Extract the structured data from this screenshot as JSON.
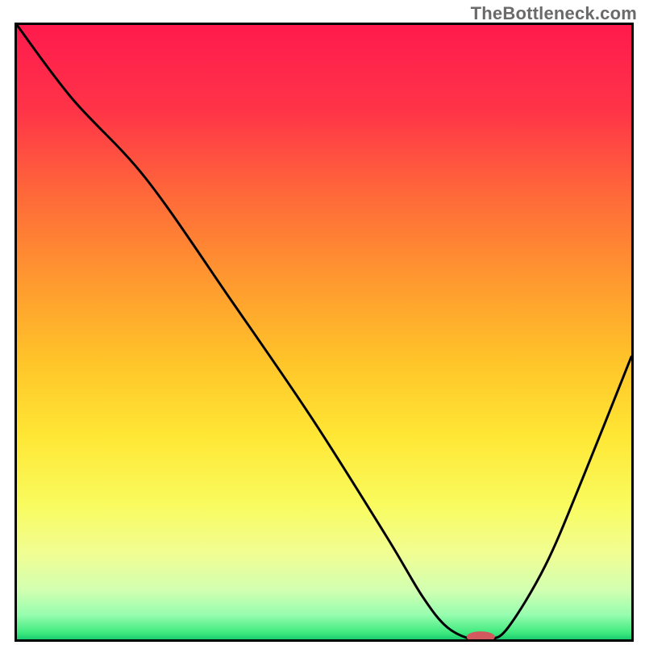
{
  "watermark": "TheBottleneck.com",
  "chart_data": {
    "type": "line",
    "title": "",
    "xlabel": "",
    "ylabel": "",
    "xlim": [
      0,
      100
    ],
    "ylim": [
      0,
      100
    ],
    "background_gradient": {
      "stops": [
        {
          "y": 0,
          "color": "#ff1a4d"
        },
        {
          "y": 14,
          "color": "#ff3448"
        },
        {
          "y": 28,
          "color": "#ff6a39"
        },
        {
          "y": 42,
          "color": "#ff9a2f"
        },
        {
          "y": 55,
          "color": "#ffc529"
        },
        {
          "y": 67,
          "color": "#ffe735"
        },
        {
          "y": 78,
          "color": "#f9fb5e"
        },
        {
          "y": 86,
          "color": "#f1fe93"
        },
        {
          "y": 92,
          "color": "#d2ffb1"
        },
        {
          "y": 96,
          "color": "#97fdaf"
        },
        {
          "y": 99,
          "color": "#3de97e"
        },
        {
          "y": 100,
          "color": "#1acb6e"
        }
      ]
    },
    "series": [
      {
        "name": "curve",
        "x": [
          0,
          9,
          21,
          35,
          48,
          60,
          66,
          70,
          74,
          77,
          80,
          86,
          92,
          100
        ],
        "y": [
          100,
          88,
          75,
          55,
          36,
          17,
          7,
          2,
          0,
          0,
          2,
          12,
          26,
          46
        ]
      }
    ],
    "marker": {
      "x": 75.5,
      "y": 0,
      "rx": 2.3,
      "ry": 0.9,
      "color": "#d25a5f"
    }
  }
}
